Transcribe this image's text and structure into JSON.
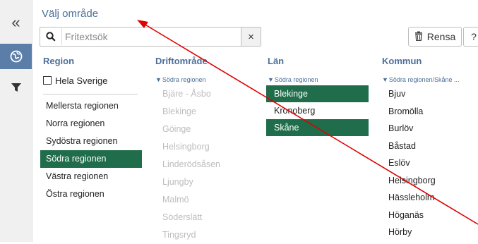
{
  "panel": {
    "title": "Välj område"
  },
  "rail": {
    "collapse_icon": "double-chevron-left-icon",
    "globe_icon": "globe-icon",
    "filter_icon": "filter-icon"
  },
  "search": {
    "placeholder": "Fritextsök",
    "value": "",
    "clear_label": "×"
  },
  "toolbar": {
    "rensa_label": "Rensa",
    "help_label": "?"
  },
  "columns": {
    "region": {
      "header": "Region",
      "all_label": "Hela Sverige",
      "items": [
        {
          "label": "Mellersta regionen",
          "selected": false
        },
        {
          "label": "Norra regionen",
          "selected": false
        },
        {
          "label": "Sydöstra regionen",
          "selected": false
        },
        {
          "label": "Södra regionen",
          "selected": true
        },
        {
          "label": "Västra regionen",
          "selected": false
        },
        {
          "label": "Östra regionen",
          "selected": false
        }
      ]
    },
    "driftomrade": {
      "header": "Driftområde",
      "filter": "Södra regionen",
      "items": [
        "Bjäre - Åsbo",
        "Blekinge",
        "Göinge",
        "Helsingborg",
        "Linderödsåsen",
        "Ljungby",
        "Malmö",
        "Söderslätt",
        "Tingsryd"
      ]
    },
    "lan": {
      "header": "Län",
      "filter": "Södra regionen",
      "items": [
        {
          "label": "Blekinge",
          "selected": true
        },
        {
          "label": "Kronoberg",
          "selected": false
        },
        {
          "label": "Skåne",
          "selected": true
        }
      ]
    },
    "kommun": {
      "header": "Kommun",
      "filter": "Södra regionen/Skåne ...",
      "items": [
        "Bjuv",
        "Bromölla",
        "Burlöv",
        "Båstad",
        "Eslöv",
        "Helsingborg",
        "Hässleholm",
        "Höganäs",
        "Hörby"
      ]
    }
  },
  "colors": {
    "accent": "#4a6f9a",
    "selected_bg": "#1f6d4a",
    "annotation_arrow": "#e00000"
  }
}
